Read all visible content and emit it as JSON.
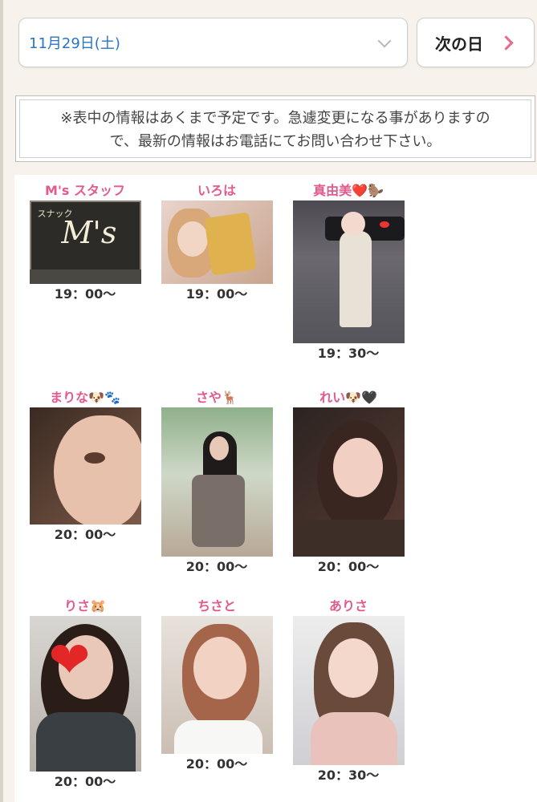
{
  "date_selector": {
    "value": "11月29日(土)"
  },
  "next_day_button": {
    "label": "次の日"
  },
  "notice": {
    "line1": "※表中の情報はあくまで予定です。急遽変更になる事がありますの",
    "line2": "で、最新の情報はお電話にてお問い合わせ下さい。"
  },
  "logo_lettering": {
    "small": "スナック",
    "large": "M's"
  },
  "casts": [
    {
      "name": "M's スタッフ",
      "time": "19：00〜"
    },
    {
      "name": "いろは",
      "time": "19：00〜"
    },
    {
      "name": "真由美❤️🦫",
      "time": "19：30〜"
    },
    {
      "name": "まりな🐶🐾",
      "time": "20：00〜"
    },
    {
      "name": "さや🦌",
      "time": "20：00〜"
    },
    {
      "name": "れい🐶🖤",
      "time": "20：00〜"
    },
    {
      "name": "りさ🐹",
      "time": "20：00〜"
    },
    {
      "name": "ちさと",
      "time": "20：00〜"
    },
    {
      "name": "ありさ",
      "time": "20：30〜"
    }
  ],
  "colors": {
    "name_pink": "#e35a8c",
    "date_blue": "#2a74c6",
    "arrow_pink": "#e46c8a"
  }
}
